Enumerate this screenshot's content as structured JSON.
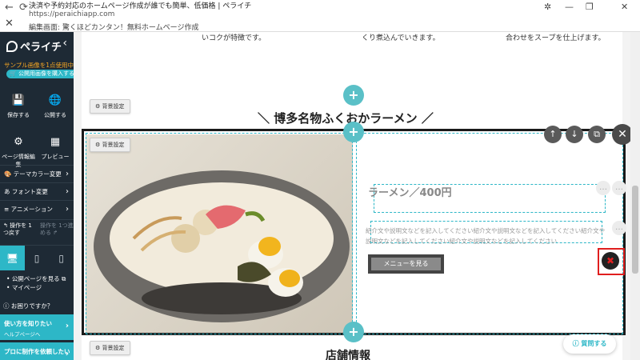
{
  "browser": {
    "title": "決済や予約対応のホームページ作成が誰でも簡単、低価格 | ペライチ",
    "url": "https://peraichiapp.com",
    "subtitle": "編集画面: 驚くほどカンタン！無料ホームページ作成"
  },
  "sidebar": {
    "logo": "ペライチ",
    "sample_note": "サンプル画像を1点使用中です",
    "buy_button": "🛒 公開用画像を購入する",
    "actions": [
      {
        "icon": "💾",
        "label": "保存する"
      },
      {
        "icon": "🌐",
        "label": "公開する"
      },
      {
        "icon": "⚙",
        "label": "ページ情報編集"
      },
      {
        "icon": "▦",
        "label": "プレビュー"
      }
    ],
    "menu": [
      "テーマカラー変更",
      "フォント変更",
      "アニメーション"
    ],
    "undo_label": "操作を 1つ戻す",
    "redo_label": "操作を 1つ進める",
    "links": [
      "公開ページを見る",
      "マイページ"
    ],
    "help_question": "お困りですか？",
    "cta1_title": "使い方を知りたい",
    "cta1_sub": "ヘルプページへ",
    "cta2_title": "プロに制作を依頼したい"
  },
  "canvas": {
    "top_texts": [
      "いコクが特徴です。",
      "くり煮込んでいきます。",
      "合わせをスープを仕上げます。"
    ],
    "bg_button": "背景設定",
    "section_title": "＼ 博多名物ふくおかラーメン ／",
    "price": "ラーメン／400円",
    "description": "紹介文や説明文などを記入してください紹介文や説明文などを記入してください紹介文や説明文などを記入してください紹介文や説明文などを記入してください",
    "menu_button": "メニューを見る",
    "store_title": "店舗情報",
    "help_fab": "質問する"
  }
}
